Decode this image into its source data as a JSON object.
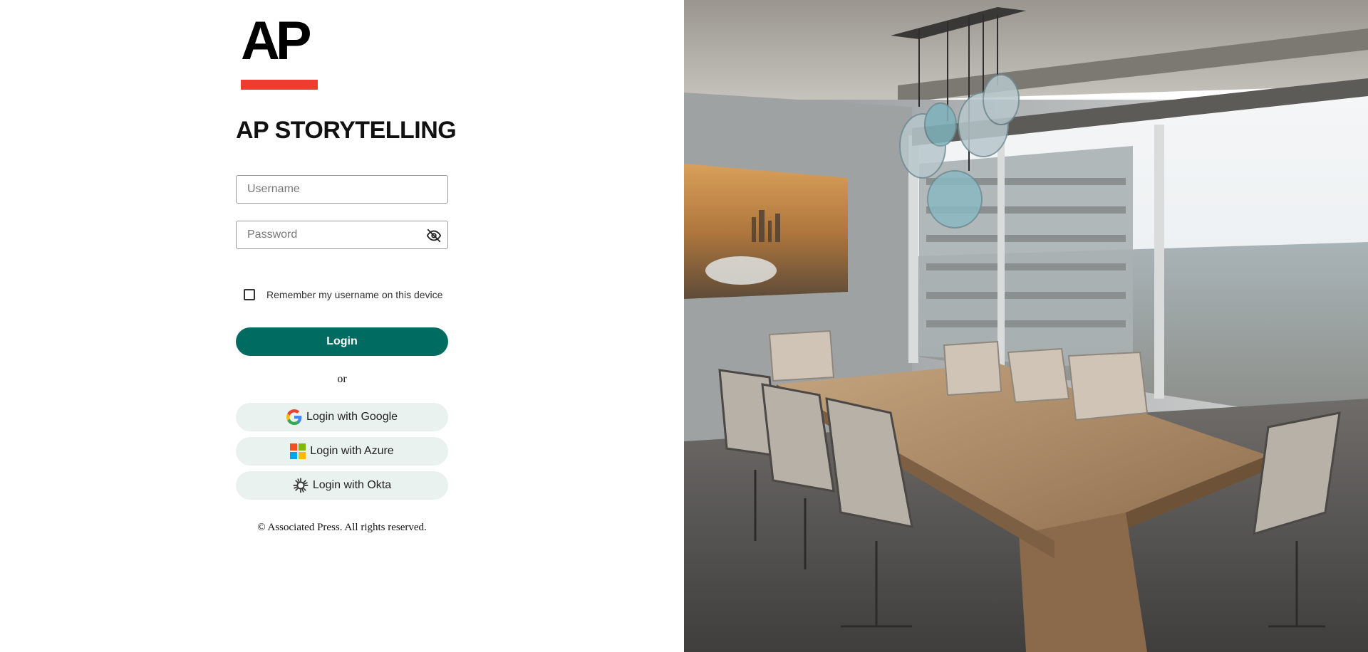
{
  "brand": {
    "logo_text": "AP",
    "logo_bar_color": "#ef3b30",
    "title": "AP STORYTELLING"
  },
  "login_form": {
    "username_placeholder": "Username",
    "password_placeholder": "Password",
    "password_toggle_icon": "eye-slash-icon",
    "remember_label": "Remember my username on this device",
    "remember_checked": false,
    "login_label": "Login",
    "login_color": "#006b60",
    "or_label": "or"
  },
  "sso": [
    {
      "label": "Login with Google",
      "icon": "google-icon"
    },
    {
      "label": "Login with Azure",
      "icon": "microsoft-icon"
    },
    {
      "label": "Login with Okta",
      "icon": "okta-icon"
    }
  ],
  "footer": {
    "copyright": "© Associated Press. All rights reserved."
  },
  "background_image": {
    "subject": "conference-room-photo"
  }
}
